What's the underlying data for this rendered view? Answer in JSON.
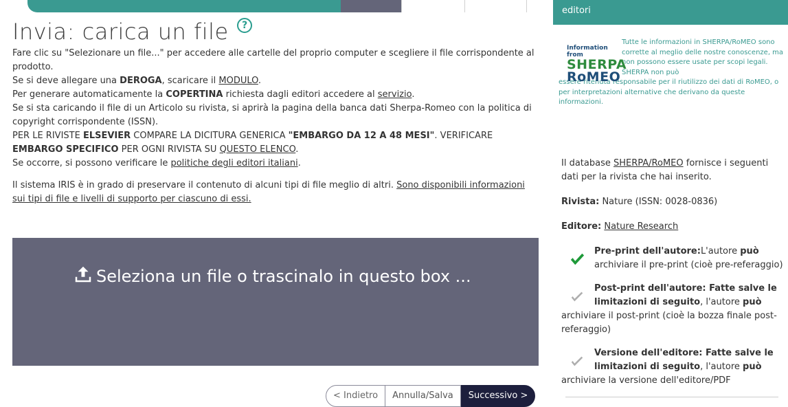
{
  "page": {
    "title": "Invia: carica un file",
    "instructions": {
      "line1": "Fare clic su \"Selezionare un file...\" per accedere alle cartelle del proprio computer e scegliere il file corrispondente al prodotto.",
      "line2_pre": "Se si deve allegare una ",
      "line2_bold": "DEROGA",
      "line2_mid": ", scaricare il ",
      "line2_link": "MODULO",
      "line2_end": ".",
      "line3_pre": "Per generare automaticamente la ",
      "line3_bold": "COPERTINA",
      "line3_mid": " richiesta dagli editori accedere al ",
      "line3_link": "servizio",
      "line3_end": ".",
      "line4": "Se si sta caricando il file di un Articolo su rivista, si aprirà la pagina della banca dati Sherpa-Romeo con la politica di copyright corrispondente (ISSN).",
      "line5_pre": "PER LE RIVISTE ",
      "line5_bold1": "ELSEVIER",
      "line5_mid": " COMPARE LA DICITURA GENERICA ",
      "line5_bold2": "\"EMBARGO DA 12 A 48 MESI\"",
      "line5_mid2": ". VERIFICARE ",
      "line5_bold3": "EMBARGO SPECIFICO",
      "line5_mid3": " PER OGNI RIVISTA SU ",
      "line5_link": "QUESTO ELENCO",
      "line5_end": ".",
      "line6_pre": "Se occorre, si possono verificare le ",
      "line6_link": "politiche degli editori italiani",
      "line6_end": ".",
      "support_pre": "Il sistema IRIS è in grado di preservare il contenuto di alcuni tipi di file meglio di altri. ",
      "support_link": "Sono disponibili informazioni sui tipi di file e livelli di supporto per ciascuno di essi."
    },
    "dropzone_label": "Seleziona un file o trascinalo in questo box ...",
    "buttons": {
      "back": "< Indietro",
      "cancel": "Annulla/Salva",
      "next": "Successivo >"
    }
  },
  "sidebar": {
    "header": "editori",
    "logo": {
      "line1": "Information from",
      "line2": "SHERPA",
      "line3": "RoMEO"
    },
    "disclaimer_a": "Tutte le informazioni in SHERPA/RoMEO sono corrette al meglio delle nostre conoscenze, ma non possono essere usate per scopi legali. SHERPA non può",
    "disclaimer_b": "essere ritenuta responsabile per il riutilizzo dei dati di RoMEO, o per interpretazioni alternative che derivano da queste informazioni.",
    "intro_pre": "Il database ",
    "intro_link": "SHERPA/RoMEO",
    "intro_end": " fornisce i seguenti dati per la rivista che hai inserito.",
    "journal_label": "Rivista:",
    "journal_value": " Nature (ISSN: 0028-0836)",
    "publisher_label": "Editore:",
    "publisher_link": "Nature Research",
    "perm1_title": "Pre-print dell'autore:",
    "perm1_a": "L'autore ",
    "perm1_bold": "può",
    "perm1_b": "archiviare il pre-print (cioè pre-referaggio)",
    "perm2_title": "Post-print dell'autore: Fatte salve le limitazioni di seguito",
    "perm2_a": ", l'autore ",
    "perm2_bold": "può",
    "perm2_b": "archiviare il post-print (cioè la bozza finale post-referaggio)",
    "perm3_title": "Versione dell'editore: Fatte salve le limitazioni di seguito",
    "perm3_a": ", l'autore ",
    "perm3_bold": "può",
    "perm3_b": "archiviare la versione dell'editore/PDF"
  }
}
